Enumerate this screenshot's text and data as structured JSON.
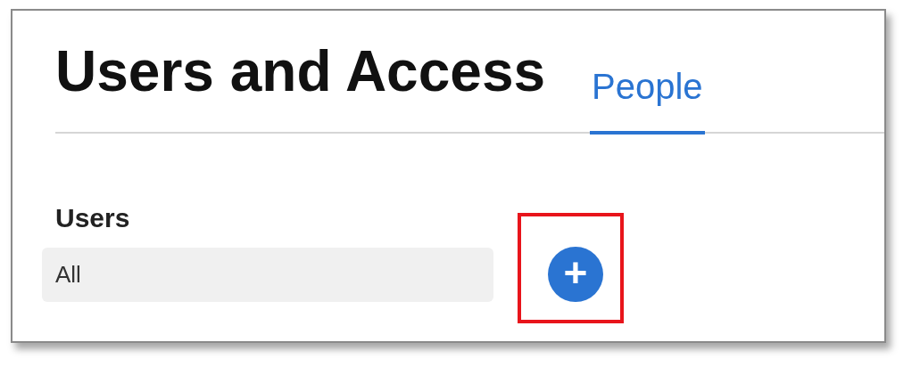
{
  "title": "Users and Access",
  "tabs": [
    {
      "label": "People",
      "selected": true
    }
  ],
  "users": {
    "label": "Users",
    "filter": {
      "value": "All"
    },
    "add_button": {
      "label": "+",
      "highlighted": true
    }
  }
}
